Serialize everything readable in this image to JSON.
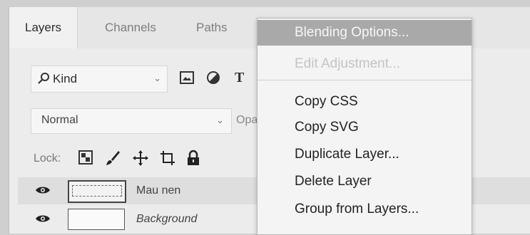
{
  "tabs": [
    "Layers",
    "Channels",
    "Paths"
  ],
  "filter": {
    "kind_label": "Kind",
    "type_icon": "T"
  },
  "blend": {
    "mode": "Normal",
    "opacity_label": "Opac"
  },
  "lock": {
    "label": "Lock:"
  },
  "layers": [
    {
      "name": "Mau nen",
      "visible": true,
      "selected": true
    },
    {
      "name": "Background",
      "visible": true,
      "selected": false
    }
  ],
  "context_menu": {
    "items": [
      {
        "label": "Blending Options...",
        "state": "highlighted"
      },
      {
        "label": "Edit Adjustment...",
        "state": "disabled"
      },
      {
        "label": "Copy CSS",
        "state": "normal"
      },
      {
        "label": "Copy SVG",
        "state": "normal"
      },
      {
        "label": "Duplicate Layer...",
        "state": "normal"
      },
      {
        "label": "Delete Layer",
        "state": "normal"
      },
      {
        "label": "Group from Layers...",
        "state": "normal"
      }
    ]
  }
}
